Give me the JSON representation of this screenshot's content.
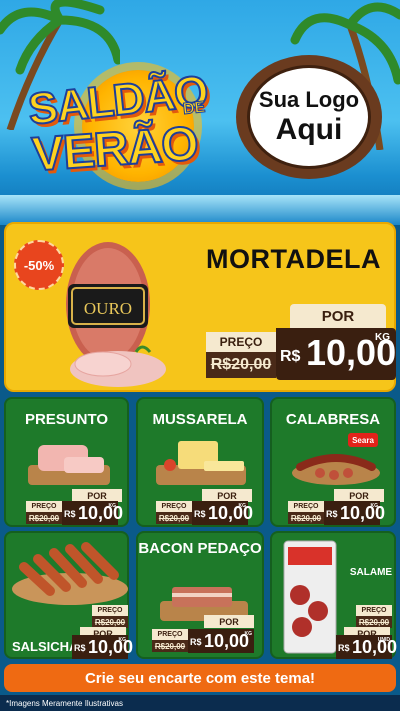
{
  "header": {
    "title_line1": "SALDÃO",
    "title_de": "DE",
    "title_line2": "VERÃO",
    "logo_line1": "Sua Logo",
    "logo_line2": "Aqui"
  },
  "featured": {
    "discount": "-50%",
    "name": "MORTADELA",
    "brand": "OURO",
    "preco_label": "PREÇO",
    "old_price": "R$20,00",
    "por_label": "POR",
    "currency": "R$",
    "new_price": "10,00",
    "unit": "KG"
  },
  "products": [
    {
      "name": "PRESUNTO",
      "preco_label": "PREÇO",
      "old_price": "R$20,00",
      "por_label": "POR",
      "currency": "R$",
      "new_price": "10,00",
      "unit": "KG"
    },
    {
      "name": "MUSSARELA",
      "preco_label": "PREÇO",
      "old_price": "R$20,00",
      "por_label": "POR",
      "currency": "R$",
      "new_price": "10,00",
      "unit": "KG"
    },
    {
      "name": "CALABRESA",
      "preco_label": "PREÇO",
      "old_price": "R$20,00",
      "por_label": "POR",
      "currency": "R$",
      "new_price": "10,00",
      "unit": "KG",
      "brand": "Seara"
    },
    {
      "name": "SALSICHA",
      "preco_label": "PREÇO",
      "old_price": "R$20,00",
      "por_label": "POR",
      "currency": "R$",
      "new_price": "10,00",
      "unit": "KG"
    },
    {
      "name": "BACON PEDAÇO",
      "preco_label": "PREÇO",
      "old_price": "R$20,00",
      "por_label": "POR",
      "currency": "R$",
      "new_price": "10,00",
      "unit": "KG"
    },
    {
      "name": "SALAME",
      "preco_label": "PREÇO",
      "old_price": "R$20,00",
      "por_label": "POR",
      "currency": "R$",
      "new_price": "10,00",
      "unit": "UNID"
    }
  ],
  "cta": "Crie seu encarte com este tema!",
  "footer": "*Imagens Meramente Ilustrativas",
  "colors": {
    "card_green": "#1e7a2a",
    "featured_yellow": "#f6c51a",
    "cta_orange": "#ef6a12",
    "price_brown": "#3a1f10"
  }
}
